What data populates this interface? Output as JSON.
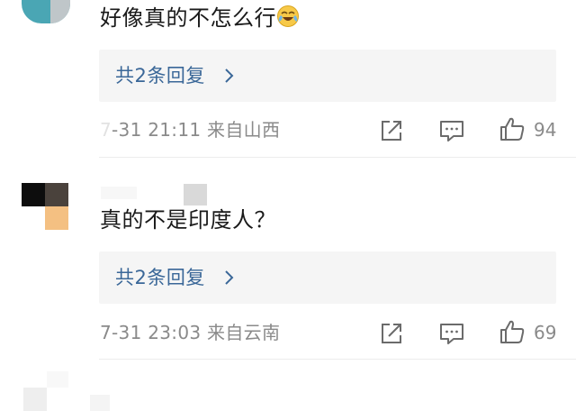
{
  "comments": [
    {
      "text": "好像真的不怎么行",
      "emoji_icon": "laugh-cry-emoji-icon",
      "reply_link": "共2条回复",
      "meta": "7-31 21:11  来自山西",
      "likes": "94"
    },
    {
      "text": "真的不是印度人？",
      "reply_link": "共2条回复",
      "meta": "7-31 23:03  来自云南",
      "likes": "69"
    }
  ],
  "icons": {
    "share": "share-icon",
    "comment": "comment-icon",
    "like": "thumbs-up-icon",
    "reply_arrow": "chevron-right-icon"
  },
  "colors": {
    "link": "#3a6798",
    "meta": "#8a8a8a",
    "reply_bg": "#f5f5f5"
  }
}
